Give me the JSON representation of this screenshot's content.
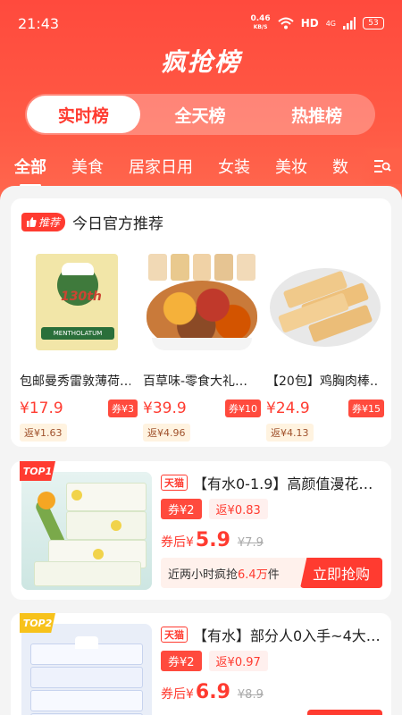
{
  "status": {
    "time": "21:43",
    "net_speed_value": "0.46",
    "net_speed_unit": "KB/S",
    "hd": "HD",
    "signal": "4G",
    "battery": "53"
  },
  "app_title": "疯抢榜",
  "segments": [
    "实时榜",
    "全天榜",
    "热推榜"
  ],
  "categories": [
    "全部",
    "美食",
    "居家日用",
    "女装",
    "美妆",
    "数"
  ],
  "recommend": {
    "badge": "推荐",
    "title": "今日官方推荐",
    "items": [
      {
        "name": "包邮曼秀雷敦薄荷…",
        "price": "¥17.9",
        "coupon": "券¥3",
        "rebate": "返¥1.63",
        "img_text": "130th",
        "img_sub": "MENTHOLATUM"
      },
      {
        "name": "百草味-零食大礼…",
        "price": "¥39.9",
        "coupon": "券¥10",
        "rebate": "返¥4.96"
      },
      {
        "name": "【20包】鸡胸肉棒…",
        "price": "¥24.9",
        "coupon": "券¥15",
        "rebate": "返¥4.13"
      }
    ]
  },
  "products": [
    {
      "rank": "TOP1",
      "store": "天猫",
      "title": "【有水0-1.9】高颜值漫花…",
      "coupon": "券¥2",
      "rebate": "返¥0.83",
      "after_label": "券后¥",
      "after_price": "5.9",
      "orig_price": "¥7.9",
      "grab_prefix": "近两小时疯抢",
      "grab_num": "6.4万",
      "grab_suffix": "件",
      "grab_btn": "立即抢购",
      "rank_color": "#ff3b30"
    },
    {
      "rank": "TOP2",
      "store": "天猫",
      "title": "【有水】部分人0入手~4大…",
      "coupon": "券¥2",
      "rebate": "返¥0.97",
      "after_label": "券后¥",
      "after_price": "6.9",
      "orig_price": "¥8.9",
      "rank_color": "#f7c21b"
    }
  ]
}
